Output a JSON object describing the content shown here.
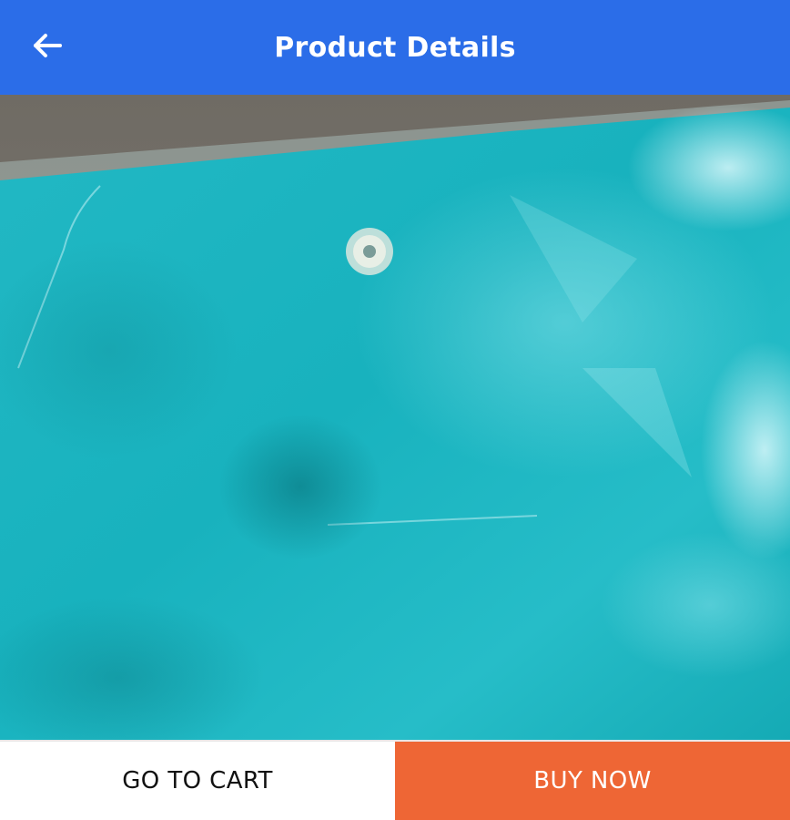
{
  "colors": {
    "header_bg": "#2b6de8",
    "cart_text": "#111111",
    "buy_bg": "#ee6635",
    "buy_text": "#ffffff",
    "fabric": "#1bb7c2",
    "fabric_dark": "#0f8f98",
    "floor": "#77736b"
  },
  "header": {
    "back_icon": "arrow-left-icon",
    "title": "Product Details"
  },
  "product": {
    "image_subject": "teal-fabric-sheet-photo"
  },
  "actions": {
    "cart_label": "GO TO CART",
    "buy_label": "BUY NOW"
  }
}
